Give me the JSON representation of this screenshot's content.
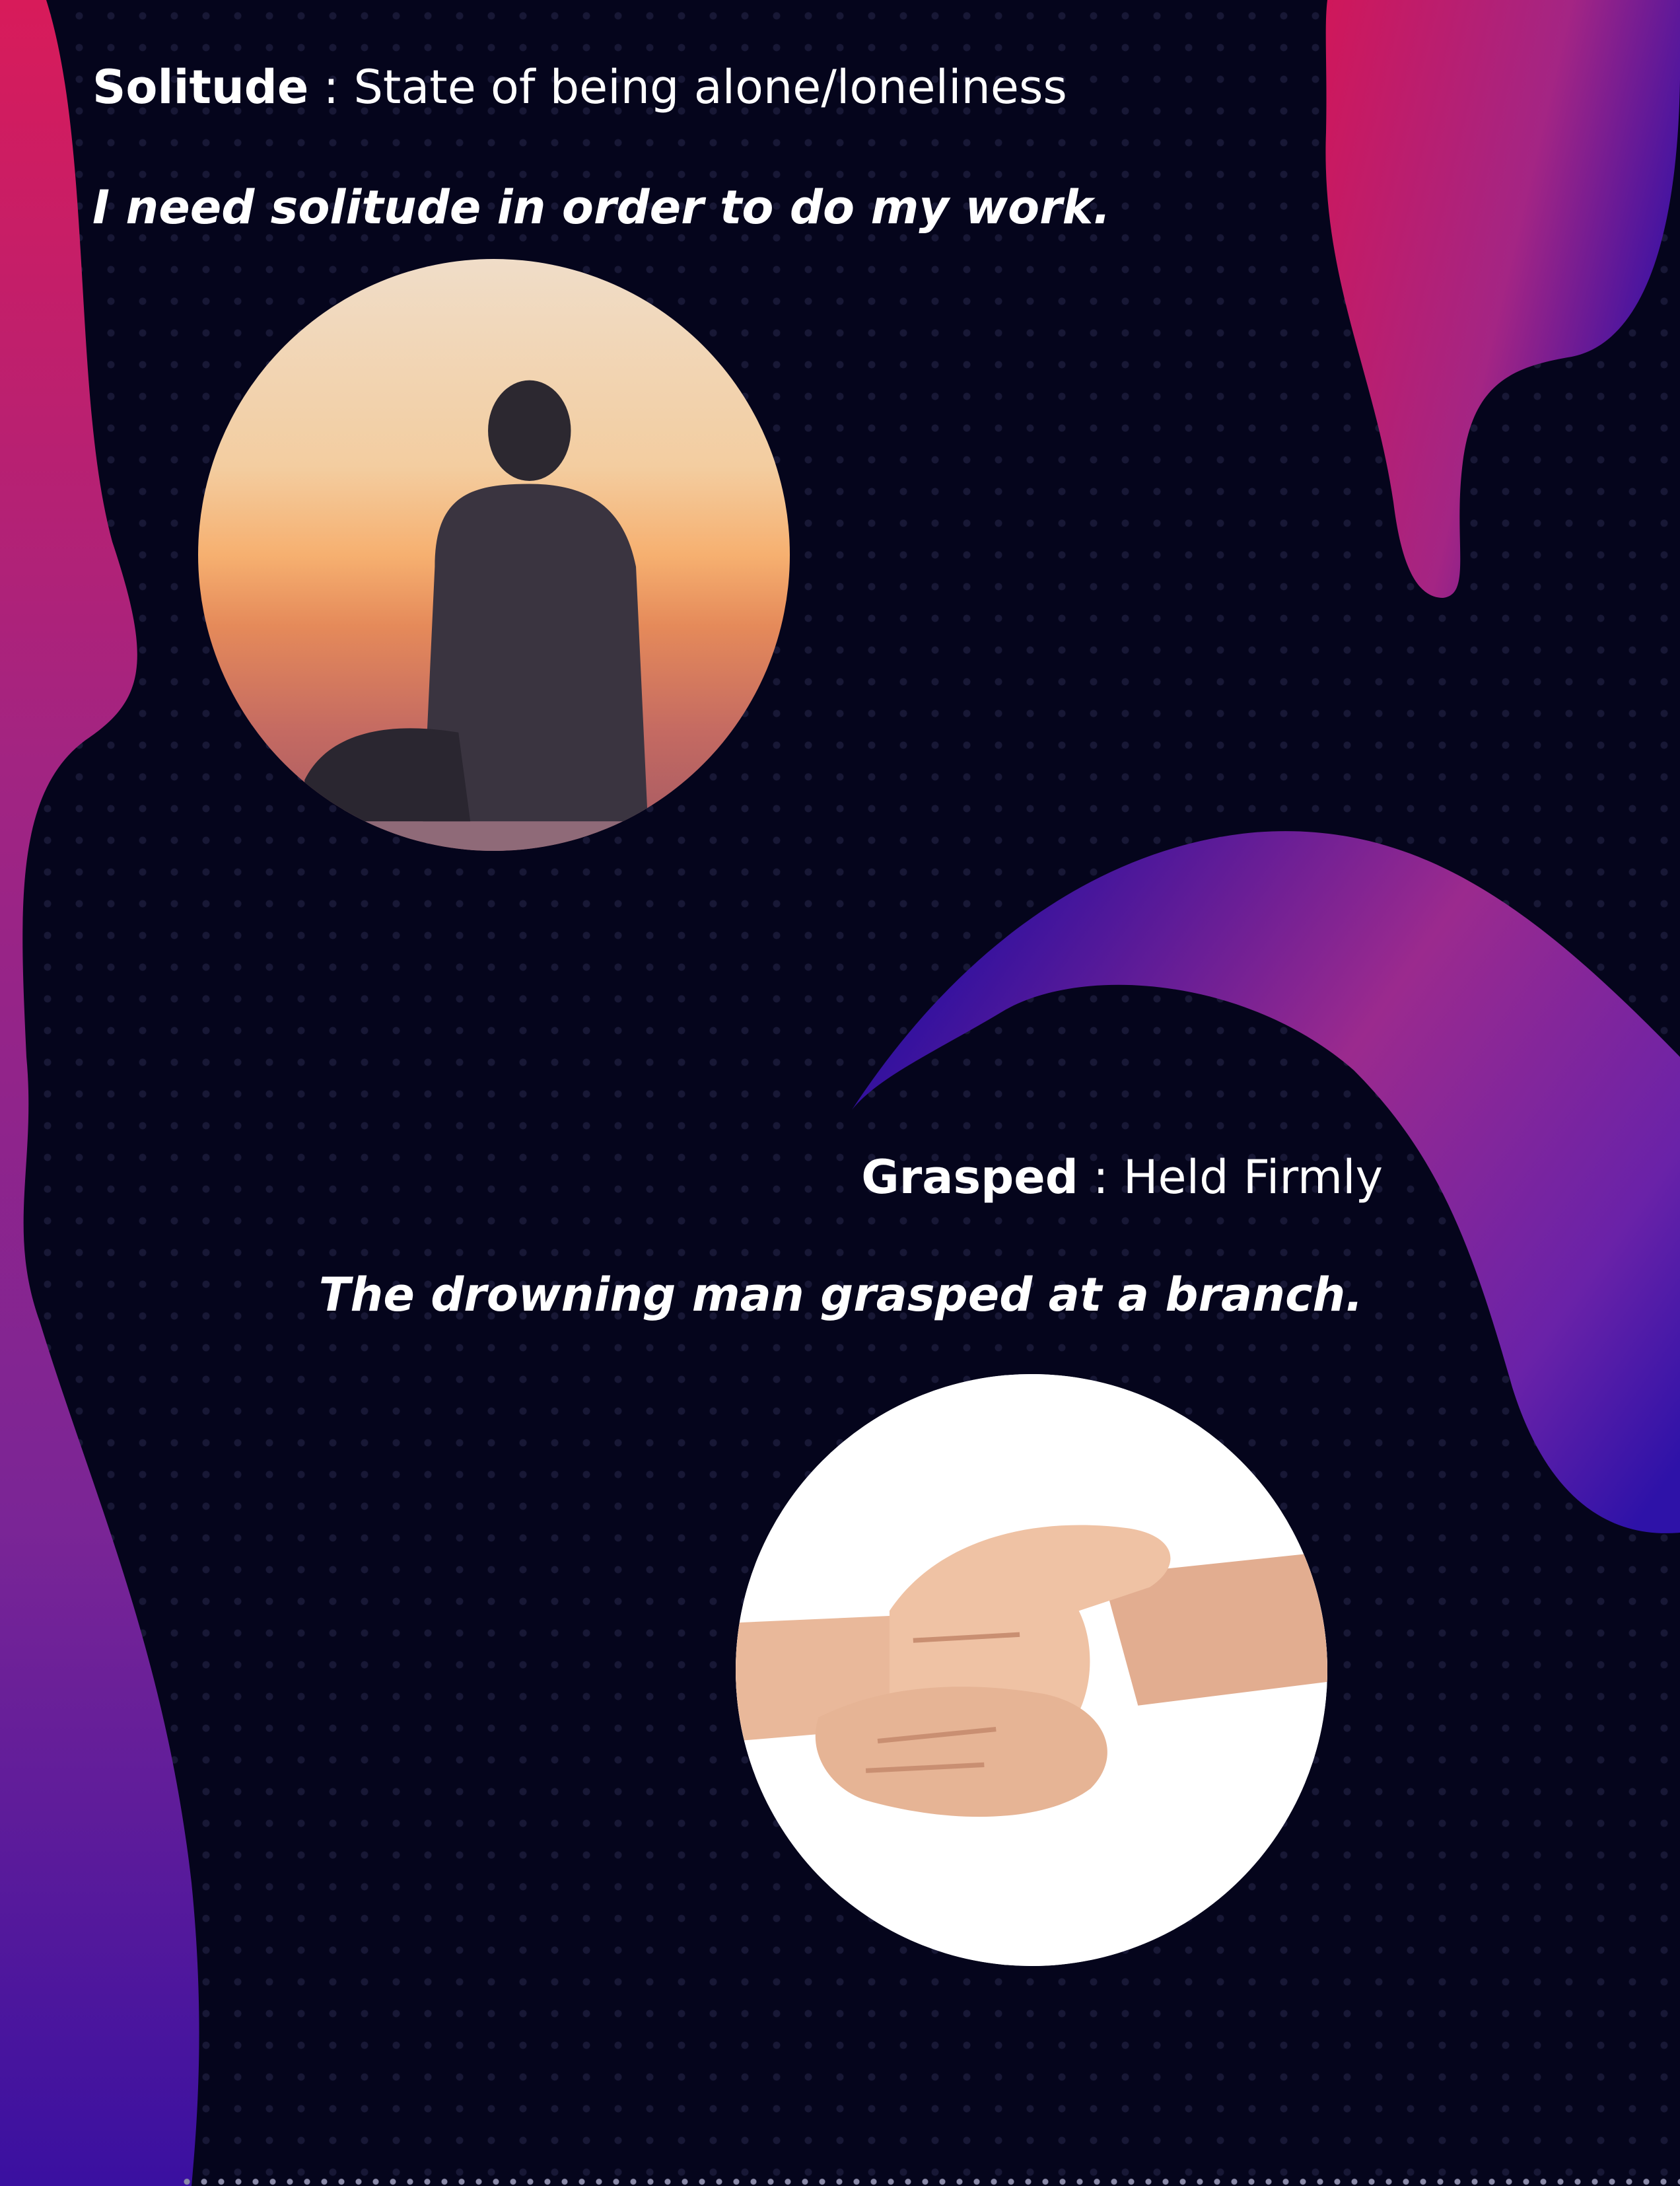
{
  "entries": [
    {
      "term": "Solitude",
      "separator": " : ",
      "definition": "State of being alone/loneliness",
      "example": "I need solitude in order to do my work.",
      "image": "man-sitting-alone-at-sunset"
    },
    {
      "term": "Grasped",
      "separator": " : ",
      "definition": "Held Firmly",
      "example": "The drowning man grasped at a branch.",
      "image": "hands-grasping-wrists"
    }
  ],
  "colors": {
    "background": "#05051c",
    "blob_pink": "#d81b5a",
    "blob_purple": "#8e2a9a",
    "blob_blue": "#2a0fa0",
    "text": "#ffffff"
  }
}
